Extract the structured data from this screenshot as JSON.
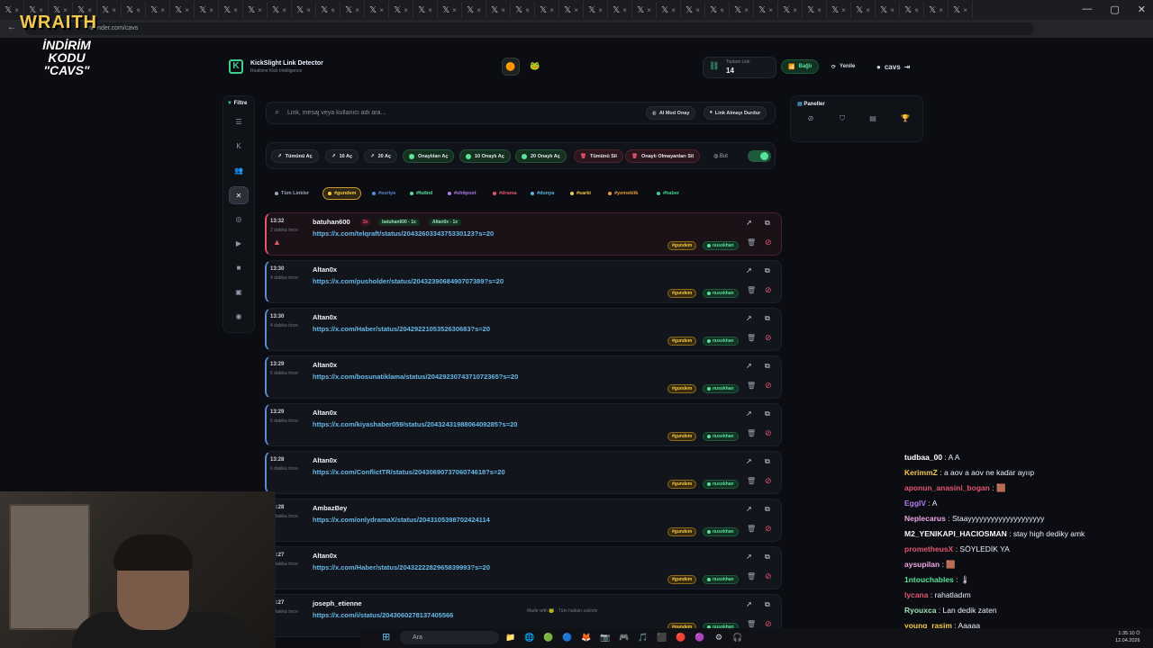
{
  "browser": {
    "url": "nrender.com/cavs",
    "tabs_count": 40
  },
  "overlay": {
    "brand": "WRAITH",
    "promo": "İNDİRİM KODU",
    "code": "\"CAVS\""
  },
  "app": {
    "title": "KickSlight Link Detector",
    "subtitle": "Realtime Kick Intelligence",
    "stat_label": "Toplam Link",
    "stat_value": "14",
    "connected": "Bağlı",
    "refresh": "Yenile",
    "user": "cavs"
  },
  "sidebar": {
    "filter_label": "Filtre"
  },
  "search": {
    "placeholder": "Link, mesaj veya kullanıcı adı ara...",
    "ai_mode": "AI Mod Onay",
    "stop": "Link Almayı Durdur"
  },
  "actions": {
    "open_all": "Tümünü Aç",
    "open10": "10 Aç",
    "open20": "20 Aç",
    "open_approved": "Onaylıları Aç",
    "approve10": "10 Onaylı Aç",
    "approve20": "20 Onaylı Aç",
    "delete_all": "Tümünü Sil",
    "delete_unapproved": "Onaylı Olmayanları Sil",
    "bot": "Bot"
  },
  "tags": [
    {
      "label": "Tüm Linkler",
      "color": "#9aa3b2"
    },
    {
      "label": "#gundem",
      "color": "#f2c94c"
    },
    {
      "label": "#suriye",
      "color": "#5b8bd9"
    },
    {
      "label": "#futbol",
      "color": "#58e29c"
    },
    {
      "label": "#shitpost",
      "color": "#b07ae8"
    },
    {
      "label": "#drama",
      "color": "#e5556f"
    },
    {
      "label": "#dunya",
      "color": "#5bb6e8"
    },
    {
      "label": "#sarki",
      "color": "#f2c94c"
    },
    {
      "label": "#yemeklik",
      "color": "#e89a3c"
    },
    {
      "label": "#haber",
      "color": "#3fcf8e"
    }
  ],
  "cards": [
    {
      "time": "13:32",
      "ago": "2 dakika önce",
      "user": "batuhan600",
      "count": "2x",
      "meta1": "batuhan600 - 1x",
      "meta2": "Altan0x - 1x",
      "link": "https://x.com/telqraft/status/2043260334375330123?s=20",
      "tag": "#gundem",
      "mod": "nusokhan"
    },
    {
      "time": "13:30",
      "ago": "4 dakika önce",
      "user": "Altan0x",
      "link": "https://x.com/pusholder/status/2043239068490707389?s=20",
      "tag": "#gundem",
      "mod": "nusokhan"
    },
    {
      "time": "13:30",
      "ago": "4 dakika önce",
      "user": "Altan0x",
      "link": "https://x.com/Haber/status/2042922105352630683?s=20",
      "tag": "#gundem",
      "mod": "nusokhan"
    },
    {
      "time": "13:29",
      "ago": "5 dakika önce",
      "user": "Altan0x",
      "link": "https://x.com/bosunatiklama/status/2042923074371072365?s=20",
      "tag": "#gundem",
      "mod": "nusokhan"
    },
    {
      "time": "13:29",
      "ago": "5 dakika önce",
      "user": "Altan0x",
      "link": "https://x.com/kiyashaber059/status/2043243198806409285?s=20",
      "tag": "#gundem",
      "mod": "nusokhan"
    },
    {
      "time": "13:28",
      "ago": "6 dakika önce",
      "user": "Altan0x",
      "link": "https://x.com/ConflictTR/status/2043069073706074618?s=20",
      "tag": "#gundem",
      "mod": "nusokhan"
    },
    {
      "time": "13:28",
      "ago": "6 dakika önce",
      "user": "AmbazBey",
      "link": "https://x.com/onlydramaX/status/2043105398702424114",
      "tag": "#gundem",
      "mod": "nusokhan"
    },
    {
      "time": "13:27",
      "ago": "7 dakika önce",
      "user": "Altan0x",
      "link": "https://x.com/Haber/status/2043222282965839993?s=20",
      "tag": "#gundem",
      "mod": "nusokhan"
    },
    {
      "time": "13:27",
      "ago": "7 dakika önce",
      "user": "joseph_etienne",
      "link": "https://x.com/i/status/2043060278137405566",
      "tag": "#gundem",
      "mod": "nusokhan"
    }
  ],
  "panels": {
    "label": "Paneller"
  },
  "footer": "Made with 🐸 · Tüm hakları saklıdır",
  "chat": [
    {
      "user": "tudbaa_00",
      "msg": "A A",
      "color": "#ffffff"
    },
    {
      "user": "KerimmZ",
      "msg": "a aov a aov ne kadar ayııp",
      "color": "#f2c94c"
    },
    {
      "user": "aponun_anasini_bogan",
      "msg": "🟫",
      "color": "#e5556f"
    },
    {
      "user": "EggIV",
      "msg": "A",
      "color": "#b07ae8"
    },
    {
      "user": "Neplecarus",
      "msg": "Staayyyyyyyyyyyyyyyyyyyy",
      "color": "#f2a6e6"
    },
    {
      "user": "M2_YENIKAPI_HACIOSMAN",
      "msg": "stay high dediky amk",
      "color": "#f5f5f5"
    },
    {
      "user": "prometheusX",
      "msg": "SÖYLEDİK YA",
      "color": "#e5556f"
    },
    {
      "user": "aysupilan",
      "msg": "🟫",
      "color": "#f2a6e6"
    },
    {
      "user": "1ntouchables",
      "msg": "🌡",
      "color": "#58e29c"
    },
    {
      "user": "lycana",
      "msg": "rahatladım",
      "color": "#e5556f"
    },
    {
      "user": "Ryouxca",
      "msg": "Lan dedik zaten",
      "color": "#9de0b8"
    },
    {
      "user": "young_rasim",
      "msg": "Aaaaa",
      "color": "#f2c94c"
    },
    {
      "user": "tan1va06",
      "msg": "Ya bırak",
      "color": "#ffffff"
    }
  ],
  "taskbar": {
    "search": "Ara",
    "time": "1:35:10 Ö",
    "date": "12.04.2026"
  }
}
